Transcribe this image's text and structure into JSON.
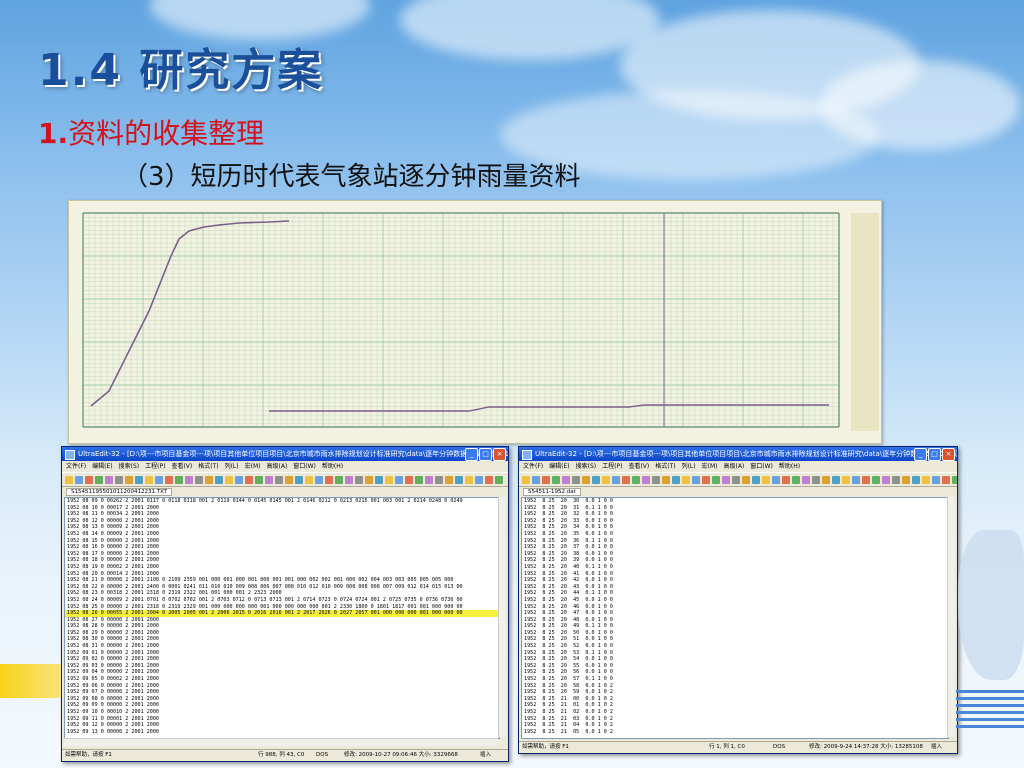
{
  "slide": {
    "title": "1.4  研究方案",
    "subtitle_number": "1.",
    "subtitle_text": "资料的收集整理",
    "subheading": "（3）短历时代表气象站逐分钟雨量资料"
  },
  "left_window": {
    "title": "UltraEdit-32 - [D:\\项---市项目基金项---项\\项目其他单位项目项目\\北京市城市雨水排除规划设计标准研究\\data\\逐年分钟数据\\原始数据\\K1...",
    "menu": [
      "文件(F)",
      "编辑(E)",
      "搜索(S)",
      "工程(P)",
      "查看(V)",
      "格式(T)",
      "列(L)",
      "宏(M)",
      "高级(A)",
      "窗口(W)",
      "帮助(H)"
    ],
    "file_tab": "S15451195501011200412231.TXT",
    "lines": [
      "1952 08 09 0 00262 2 2001 0117 0 0118 0118 001 2 0119 0144 0 0145 0145 001 2 0146 0212 0 0213 0215 001 003 001 2 0214 0248 0 0249",
      "1952 08 10 0 00017 2 2001 2000",
      "1952 08 11 0 00034 2 2001 2000",
      "1952 08 12 0 00000 2 2001 2000",
      "1952 08 13 0 00009 2 2001 2000",
      "1952 08 14 0 00009 2 2001 2000",
      "1952 08 15 0 00000 2 2001 2000",
      "1952 08 16 0 00000 2 2001 2000",
      "1952 08 17 0 00000 2 2001 2000",
      "1952 08 18 0 00000 2 2001 2000",
      "1952 08 19 0 00002 2 2001 2000",
      "1952 08 20 0 00014 2 2001 2000",
      "1952 08 21 0 00000 2 2001 2108 0 2109 2359 001 000 001 000 001 000 001 001 000 002 002 001 000 002 004 003 003 005 005 005 000",
      "1952 08 22 0 00000 2 2001 2400 0 0001 0241 011 010 010 009 008 006 007 008 010 012 010 009 008 008 008 007 009 012 014 015 013 00",
      "1952 08 23 0 00318 2 2001 2318 0 2319 2322 001 001 000 001 2 2323 2000",
      "1952 08 24 0 00009 2 2001 0701 0 0702 0702 001 2 0703 0712 0 0713 0713 001 2 0714 0723 0 0724 0724 001 2 0725 0735 0 0736 0736 00",
      "1952 08 25 0 00000 2 2001 2318 0 2319 2329 001 000 000 000 000 001 000 000 000 000 001 2 2330 1800 0 1801 1817 001 001 000 000 00",
      "1952 08 26 0 00055 2 2001 2004 0 2005 2005 001 2 2006 2015 0 2016 2016 001 2 2017 2026 0 2027 2057 001 000 000 000 001 000 000 00",
      "1952 08 27 0 00000 2 2001 2000",
      "1952 08 28 0 00000 2 2001 2000",
      "1952 08 29 0 00000 2 2001 2000",
      "1952 08 30 0 00000 2 2001 2000",
      "1952 08 31 0 00000 2 2001 2000",
      "1952 09 01 0 00000 2 2001 2000",
      "1952 09 02 0 00000 2 2001 2000",
      "1952 09 03 0 00000 2 2001 2000",
      "1952 09 04 0 00000 2 2001 2000",
      "1952 09 05 0 00002 2 2001 2000",
      "1952 09 06 0 00000 2 2001 2000",
      "1952 09 07 0 00000 2 2001 2000",
      "1952 09 08 0 00000 2 2001 2000",
      "1952 09 09 0 00000 2 2001 2000",
      "1952 09 10 0 00010 2 2001 2000",
      "1952 09 11 0 00001 2 2001 2000",
      "1952 09 12 0 00000 2 2001 2000",
      "1952 09 13 0 00000 2 2001 2000"
    ],
    "highlight_index": 17,
    "status": {
      "help": "如需帮助，请按 F1",
      "pos": "行 988, 列 43, C0",
      "dos": "DOS",
      "mod": "修改: 2009-10-27 09:06:46 大小: 3329668",
      "ins": "插入"
    }
  },
  "right_window": {
    "title": "UltraEdit-32 - [D:\\项---市项目基金项---项\\项目其他单位项目项目\\北京市城市雨水排除规划设计标准研究\\data\\逐年分钟数据\\54511\\观象台...",
    "menu": [
      "文件(F)",
      "编辑(E)",
      "搜索(S)",
      "工程(P)",
      "查看(V)",
      "格式(T)",
      "列(L)",
      "宏(M)",
      "高级(A)",
      "窗口(W)",
      "帮助(H)"
    ],
    "file_tab": "S54511-1952.dat",
    "lines": [
      "1952  8 25  20  30  0.0 1 0 0",
      "1952  8 25  20  31  0.1 1 0 0",
      "1952  8 25  20  32  0.0 1 0 0",
      "1952  8 25  20  33  0.0 1 0 0",
      "1952  8 25  20  34  0.0 1 0 0",
      "1952  8 25  20  35  0.0 1 0 0",
      "1952  8 25  20  36  0.1 1 0 0",
      "1952  8 25  20  37  0.0 1 0 0",
      "1952  8 25  20  38  0.0 1 0 0",
      "1952  8 25  20  39  0.0 1 0 0",
      "1952  8 25  20  40  0.1 1 0 0",
      "1952  8 25  20  41  0.0 1 0 0",
      "1952  8 25  20  42  0.0 1 0 0",
      "1952  8 25  20  43  0.0 1 0 0",
      "1952  8 25  20  44  0.1 1 0 0",
      "1952  8 25  20  45  0.0 1 0 0",
      "1952  8 25  20  46  0.0 1 0 0",
      "1952  8 25  20  47  0.0 1 0 0",
      "1952  8 25  20  48  0.0 1 0 0",
      "1952  8 25  20  49  0.1 1 0 0",
      "1952  8 25  20  50  0.0 1 0 0",
      "1952  8 25  20  51  0.0 1 0 0",
      "1952  8 25  20  52  0.0 1 0 0",
      "1952  8 25  20  53  0.1 1 0 0",
      "1952  8 25  20  54  0.0 1 0 0",
      "1952  8 25  20  55  0.0 1 0 0",
      "1952  8 25  20  56  0.0 1 0 0",
      "1952  8 25  20  57  0.1 1 0 0",
      "1952  8 25  20  58  0.0 1 0 2",
      "1952  8 25  20  59  0.0 1 0 2",
      "1952  8 25  21  00  0.0 1 0 2",
      "1952  8 25  21  01  0.0 1 0 2",
      "1952  8 25  21  02  0.0 1 0 2",
      "1952  8 25  21  03  0.0 1 0 2",
      "1952  8 25  21  04  0.0 1 0 2",
      "1952  8 25  21  05  0.0 1 0 2"
    ],
    "status": {
      "help": "如需帮助，请按 F1",
      "pos": "行 1, 列 1, C0",
      "dos": "DOS",
      "mod": "修改: 2009-9-24 14:37:28 大小: 13285108",
      "ins": "插入"
    }
  },
  "colors": {
    "title": "#1a4f9c",
    "subtitle": "#d4121b",
    "highlight": "#f6ee3c",
    "chart_trace": "#7a5e8c",
    "grid": "#8fc7a0"
  }
}
